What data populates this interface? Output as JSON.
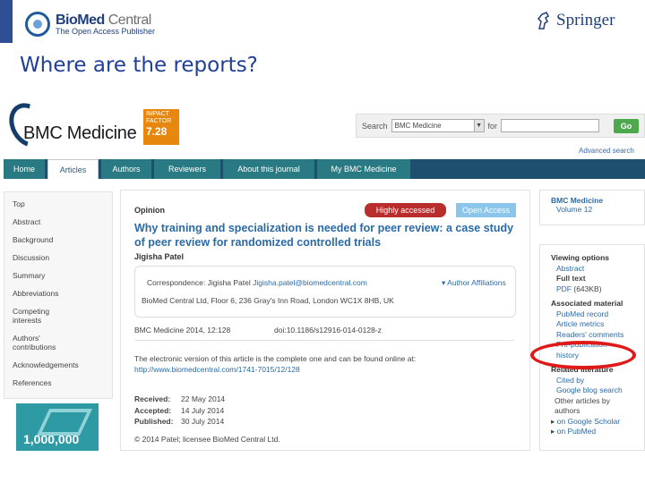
{
  "slide": {
    "publisher_logo_main": "BioMed",
    "publisher_logo_main2": "Central",
    "publisher_tagline": "The Open Access Publisher",
    "springer_logo": "Springer",
    "title": "Where are the reports?",
    "accent_color": "#1f3f98",
    "annotation_color": "#e01818"
  },
  "journal": {
    "name": "BMC Medicine",
    "impact_label_1": "IMPACT",
    "impact_label_2": "FACTOR",
    "impact_value": "7.28",
    "impact_color": "#e8870d"
  },
  "search": {
    "label": "Search",
    "scope": "BMC Medicine",
    "for_label": "for",
    "query": "",
    "go_label": "Go",
    "advanced_link": "Advanced search"
  },
  "nav": {
    "tabs": [
      "Home",
      "Articles",
      "Authors",
      "Reviewers",
      "About this journal",
      "My BMC Medicine"
    ],
    "active": "Articles"
  },
  "toc": {
    "items": [
      "Top",
      "Abstract",
      "Background",
      "Discussion",
      "Summary",
      "Abbreviations",
      "Competing",
      "interests",
      "Authors'",
      "contributions",
      "Acknowledgements",
      "References"
    ]
  },
  "ad": {
    "text": "1,000,000"
  },
  "article": {
    "type": "Opinion",
    "badge_highly": "Highly accessed",
    "badge_open": "Open Access",
    "title": "Why training and specialization is needed for peer review: a case study of peer review for randomized controlled trials",
    "author": "Jigisha Patel",
    "correspondence_label": "Correspondence: Jigisha Patel",
    "correspondence_email": "Jigisha.patel@biomedcentral.com",
    "affiliations_link": "Author Affiliations",
    "address": "BioMed Central Ltd, Floor 6, 236 Gray's Inn Road, London WC1X 8HB, UK",
    "citation": "BMC Medicine 2014, 12:128",
    "doi": "doi:10.1186/s12916-014-0128-z",
    "electronic_note": "The electronic version of this article is the complete one and can be found online at:",
    "electronic_url": "http://www.biomedcentral.com/1741-7015/12/128",
    "dates": [
      {
        "label": "Received:",
        "value": "22 May 2014"
      },
      {
        "label": "Accepted:",
        "value": "14 July 2014"
      },
      {
        "label": "Published:",
        "value": "30 July 2014"
      }
    ],
    "copyright": "© 2014 Patel; licensee BioMed Central Ltd."
  },
  "sidebar": {
    "journal": "BMC Medicine",
    "volume": "Volume 12",
    "viewing_options_heading": "Viewing options",
    "viewing_abstract": "Abstract",
    "viewing_fulltext": "Full text",
    "viewing_pdf": "PDF",
    "viewing_pdf_size": "(643KB)",
    "associated_heading": "Associated material",
    "associated_pubmed": "PubMed record",
    "associated_metrics": "Article metrics",
    "associated_comments": "Readers' comments",
    "associated_prepub": "Pre-publication",
    "associated_history": "history",
    "related_heading": "Related literature",
    "related_cited": "Cited by",
    "related_google": "Google blog search",
    "related_other_1": "Other articles by",
    "related_other_2": "authors",
    "related_scholar": "on Google Scholar",
    "related_pubmed": "on PubMed"
  }
}
